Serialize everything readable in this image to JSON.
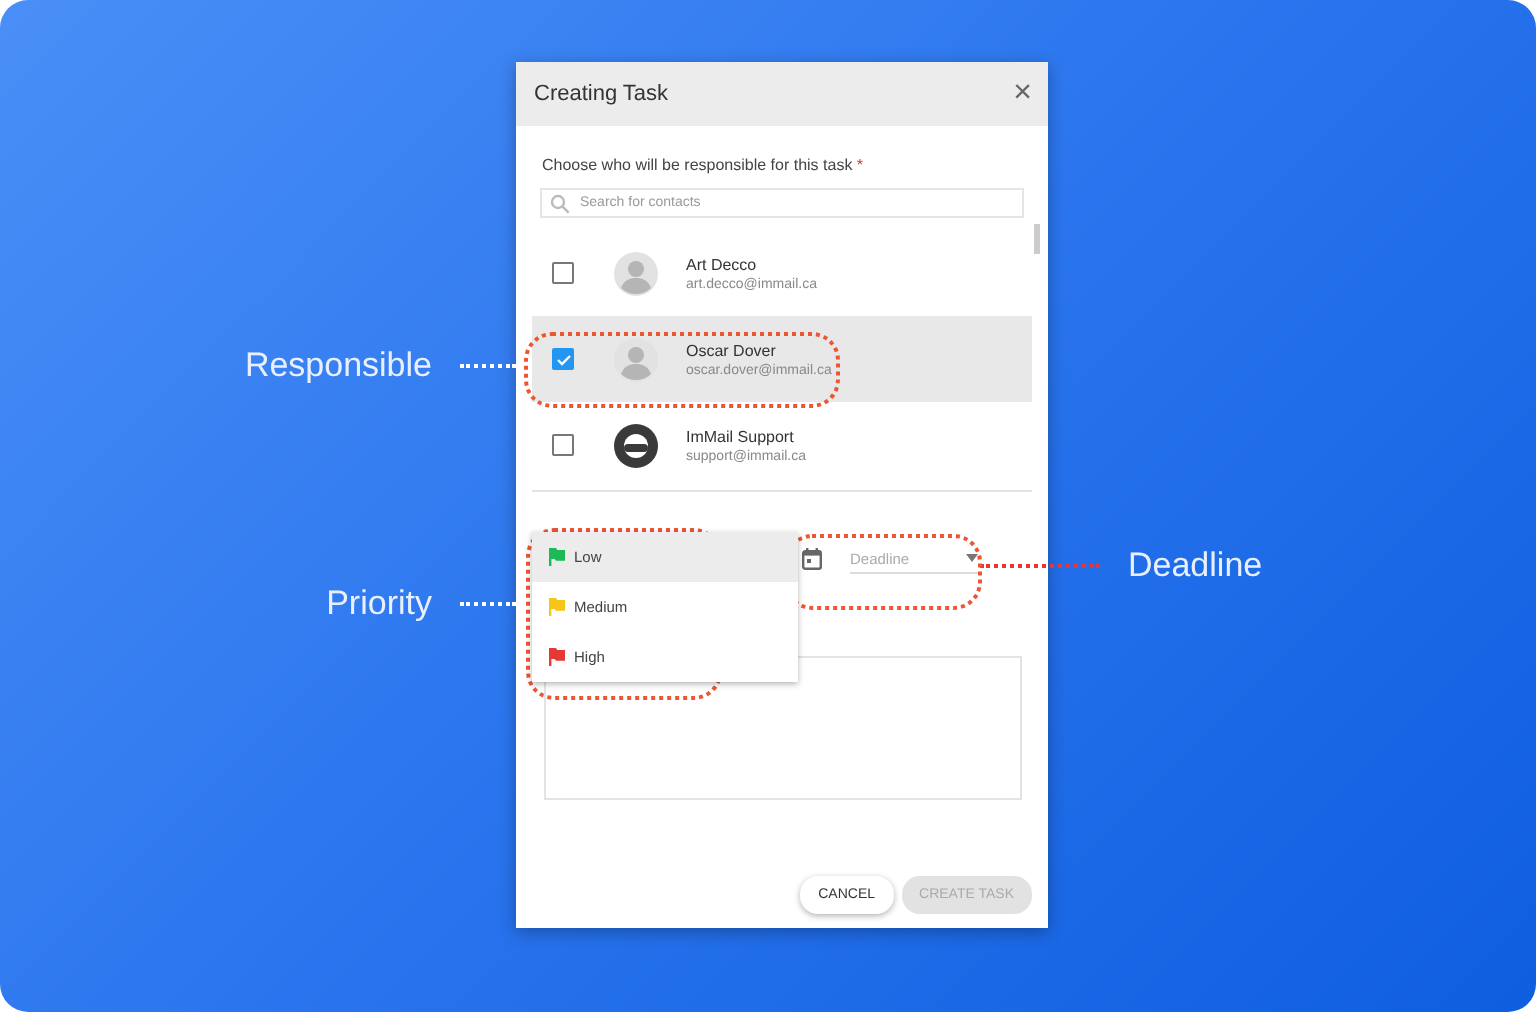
{
  "dialog": {
    "title": "Creating Task",
    "close": "×",
    "prompt": "Choose who will be responsible for this task",
    "required_mark": "*",
    "search": {
      "placeholder": "Search for contacts"
    },
    "contacts": [
      {
        "name": "Art Decco",
        "email": "art.decco@immail.ca",
        "checked": false,
        "kind": "person"
      },
      {
        "name": "Oscar Dover",
        "email": "oscar.dover@immail.ca",
        "checked": true,
        "kind": "person"
      },
      {
        "name": "ImMail Support",
        "email": "support@immail.ca",
        "checked": false,
        "kind": "support"
      }
    ],
    "priority_menu": [
      {
        "label": "Low",
        "color": "#1db954",
        "selected": true
      },
      {
        "label": "Medium",
        "color": "#f5c518",
        "selected": false
      },
      {
        "label": "High",
        "color": "#e53935",
        "selected": false
      }
    ],
    "deadline": {
      "placeholder": "Deadline"
    },
    "buttons": [
      {
        "label": "CANCEL",
        "disabled": false
      },
      {
        "label": "CREATE TASK",
        "disabled": true
      }
    ]
  },
  "callouts": [
    {
      "label": "Responsible"
    },
    {
      "label": "Priority"
    },
    {
      "label": "Deadline"
    }
  ]
}
